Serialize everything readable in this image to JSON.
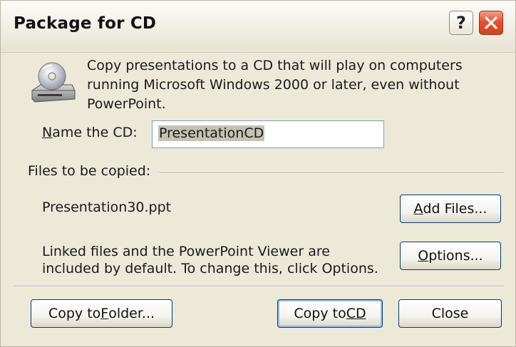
{
  "window": {
    "title": "Package for CD",
    "help_glyph": "?",
    "help_icon": "question-icon",
    "close_icon": "close-x-icon",
    "accent_close": "#e5522d"
  },
  "header": {
    "icon": "cd-drive-icon",
    "description": "Copy presentations to a CD that will play on computers running Microsoft Windows 2000 or later, even without PowerPoint."
  },
  "name_field": {
    "label_first": "N",
    "label_rest": "ame the CD:",
    "value": "PresentationCD"
  },
  "files": {
    "section_label": "Files to be copied:",
    "items": [
      "Presentation30.ppt"
    ],
    "add_files_first": "A",
    "add_files_rest": "dd Files...",
    "linked_text": "Linked files and the PowerPoint Viewer are included by default. To change this, click Options.",
    "options_first": "O",
    "options_rest": "ptions..."
  },
  "footer": {
    "copy_folder_pre": "Copy to ",
    "copy_folder_key": "F",
    "copy_folder_post": "older...",
    "copy_cd_pre": "Copy to ",
    "copy_cd_key": "CD",
    "close_label": "Close"
  }
}
